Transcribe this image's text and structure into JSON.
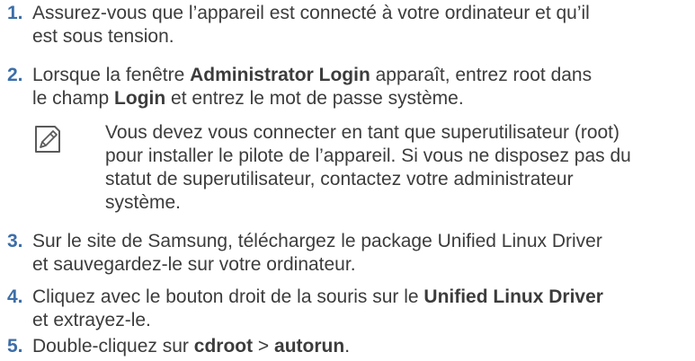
{
  "steps": [
    {
      "number": "1.",
      "line1": "Assurez-vous que l’appareil est connecté à votre ordinateur et qu’il",
      "line2": "est sous tension."
    },
    {
      "number": "2.",
      "l1_a": "Lorsque la fenêtre ",
      "l1_b": "Administrator Login",
      "l1_c": " apparaît, entrez root dans",
      "l2_a": "le champ ",
      "l2_b": "Login",
      "l2_c": " et entrez le mot de passe système."
    },
    {
      "number": "3.",
      "line1": "Sur le site de Samsung, téléchargez le package Unified Linux Driver",
      "line2": "et sauvegardez-le sur votre ordinateur."
    },
    {
      "number": "4.",
      "l1_a": "Cliquez avec le bouton droit de la souris sur le ",
      "l1_b": "Unified Linux Driver",
      "line2": "et extrayez-le."
    },
    {
      "number": "5.",
      "a": "Double-cliquez sur ",
      "b": "cdroot",
      "c": " > ",
      "d": "autorun",
      "e": "."
    }
  ],
  "note": {
    "icon": "note-pencil-icon",
    "line1": "Vous devez vous connecter en tant que superutilisateur (root)",
    "line2": "pour installer le pilote de l’appareil. Si vous ne disposez pas du",
    "line3": "statut de superutilisateur, contactez votre administrateur",
    "line4": "système."
  },
  "colors": {
    "step_number": "#3c6ea8",
    "body_text": "#3c3c3c"
  }
}
